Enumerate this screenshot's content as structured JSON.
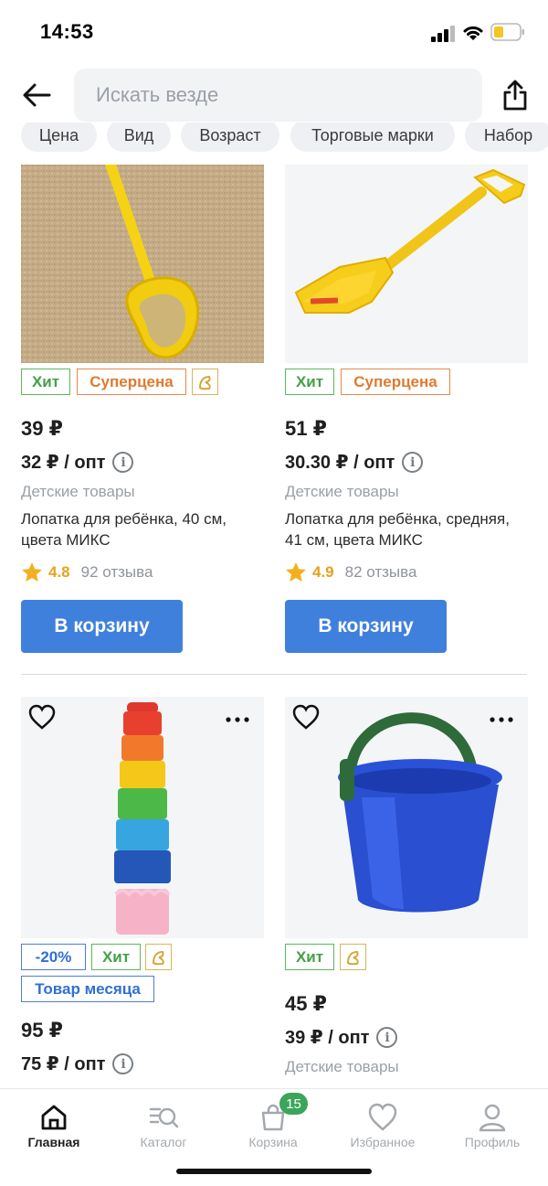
{
  "status_bar": {
    "time": "14:53"
  },
  "header": {
    "search_placeholder": "Искать везде"
  },
  "filters": [
    "Цена",
    "Вид",
    "Возраст",
    "Торговые марки",
    "Набор"
  ],
  "products": [
    {
      "tags": {
        "hit": "Хит",
        "super": "Суперцена"
      },
      "price": "39 ₽",
      "opt_price": "32 ₽ / опт",
      "category": "Детские товары",
      "name": "Лопатка для ребёнка, 40 см, цвета МИКС",
      "rating": "4.8",
      "reviews": "92 отзыва",
      "button": "В корзину"
    },
    {
      "tags": {
        "hit": "Хит",
        "super": "Суперцена"
      },
      "price": "51 ₽",
      "opt_price": "30.30 ₽ / опт",
      "category": "Детские товары",
      "name": "Лопатка для ребёнка, средняя, 41 см, цвета МИКС",
      "rating": "4.9",
      "reviews": "82 отзыва",
      "button": "В корзину"
    },
    {
      "tags": {
        "sale": "-20%",
        "hit": "Хит",
        "month": "Товар месяца"
      },
      "price": "95 ₽",
      "opt_price": "75 ₽ / опт"
    },
    {
      "tags": {
        "hit": "Хит"
      },
      "price": "45 ₽",
      "opt_price": "39 ₽ / опт",
      "category": "Детские товары"
    }
  ],
  "tabbar": {
    "home": "Главная",
    "catalog": "Каталог",
    "cart": "Корзина",
    "cart_count": "15",
    "favorites": "Избранное",
    "profile": "Профиль"
  },
  "colors": {
    "accent_button": "#3f80dd",
    "hit_green": "#43a047",
    "super_orange": "#e07a2e",
    "rating_star": "#f2b01e",
    "badge_green": "#3ba55c"
  },
  "icons": [
    "back-arrow-icon",
    "share-icon",
    "info-icon",
    "star-icon",
    "heart-icon",
    "more-icon",
    "home-icon",
    "catalog-icon",
    "cart-icon",
    "favorites-icon",
    "profile-icon"
  ]
}
